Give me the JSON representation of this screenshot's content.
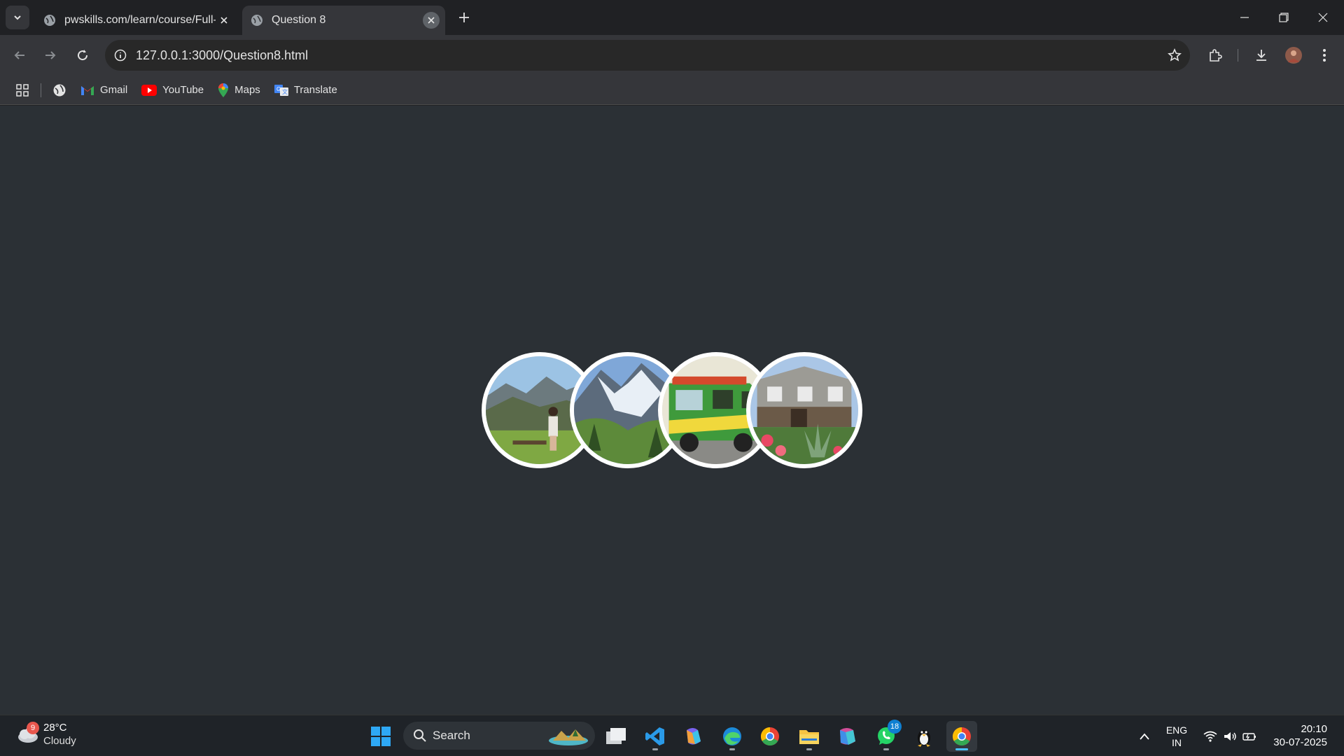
{
  "browser": {
    "tabs": [
      {
        "title": "pwskills.com/learn/course/Full-",
        "active": false
      },
      {
        "title": "Question 8",
        "active": true
      }
    ],
    "url": "127.0.0.1:3000/Question8.html",
    "bookmarks": [
      {
        "label": "Gmail",
        "icon": "gmail-icon"
      },
      {
        "label": "YouTube",
        "icon": "youtube-icon"
      },
      {
        "label": "Maps",
        "icon": "maps-icon"
      },
      {
        "label": "Translate",
        "icon": "translate-icon"
      }
    ]
  },
  "page": {
    "background": "#2b3035",
    "images": [
      {
        "name": "mountain-woman-photo"
      },
      {
        "name": "glacier-photo"
      },
      {
        "name": "food-truck-photo"
      },
      {
        "name": "house-flowers-photo"
      }
    ]
  },
  "taskbar": {
    "weather": {
      "temp": "28°C",
      "condition": "Cloudy",
      "badge": "9"
    },
    "search_label": "Search",
    "whatsapp_badge": "18",
    "language": {
      "line1": "ENG",
      "line2": "IN"
    },
    "clock": {
      "time": "20:10",
      "date": "30-07-2025"
    }
  },
  "colors": {
    "accent": "#4cc2ff",
    "circle_border": "#ffffff"
  }
}
